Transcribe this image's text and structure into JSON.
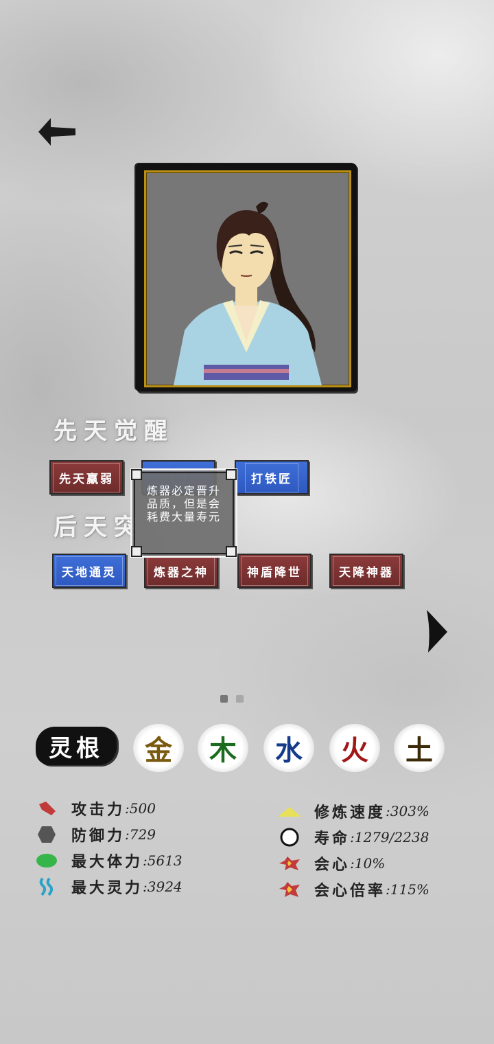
{
  "innate": {
    "heading": "先天觉醒",
    "tags": [
      {
        "label": "先天羸弱",
        "color": "red"
      },
      {
        "label": "",
        "color": "blue"
      },
      {
        "label": "打铁匠",
        "color": "blue"
      }
    ]
  },
  "acquired": {
    "heading": "后天突",
    "tags": [
      {
        "label": "天地通灵",
        "color": "blue"
      },
      {
        "label": "炼器之神",
        "color": "red"
      },
      {
        "label": "神盾降世",
        "color": "red"
      },
      {
        "label": "天降神器",
        "color": "red"
      }
    ]
  },
  "tooltip": {
    "text": "炼器必定晋升品质，但是会耗费大量寿元"
  },
  "pager": {
    "total": 2,
    "current": 1
  },
  "spirit_root": {
    "label": "灵根",
    "elements": [
      {
        "char": "金",
        "color": "#7a5a10"
      },
      {
        "char": "木",
        "color": "#1d6b1f"
      },
      {
        "char": "水",
        "color": "#143a8a"
      },
      {
        "char": "火",
        "color": "#a01818"
      },
      {
        "char": "土",
        "color": "#3b2a08"
      }
    ]
  },
  "stats_left": [
    {
      "icon": "attack-icon",
      "label": "攻击力",
      "value": ":500",
      "color": "#c23b3b"
    },
    {
      "icon": "defense-icon",
      "label": "防御力",
      "value": ":729",
      "color": "#555555"
    },
    {
      "icon": "hp-icon",
      "label": "最大体力",
      "value": ":5613",
      "color": "#36b54a"
    },
    {
      "icon": "mana-icon",
      "label": "最大灵力",
      "value": ":3924",
      "color": "#2aa3c9"
    }
  ],
  "stats_right": [
    {
      "icon": "cultivation-speed-icon",
      "label": "修炼速度",
      "value": ":303%",
      "color": "#e8e05a"
    },
    {
      "icon": "lifespan-icon",
      "label": "寿命",
      "value": ":1279/2238",
      "color": "#111111"
    },
    {
      "icon": "crit-icon",
      "label": "会心",
      "value": ":10%",
      "color": "#c23b3b"
    },
    {
      "icon": "crit-multiplier-icon",
      "label": "会心倍率",
      "value": ":115%",
      "color": "#c23b3b"
    }
  ]
}
